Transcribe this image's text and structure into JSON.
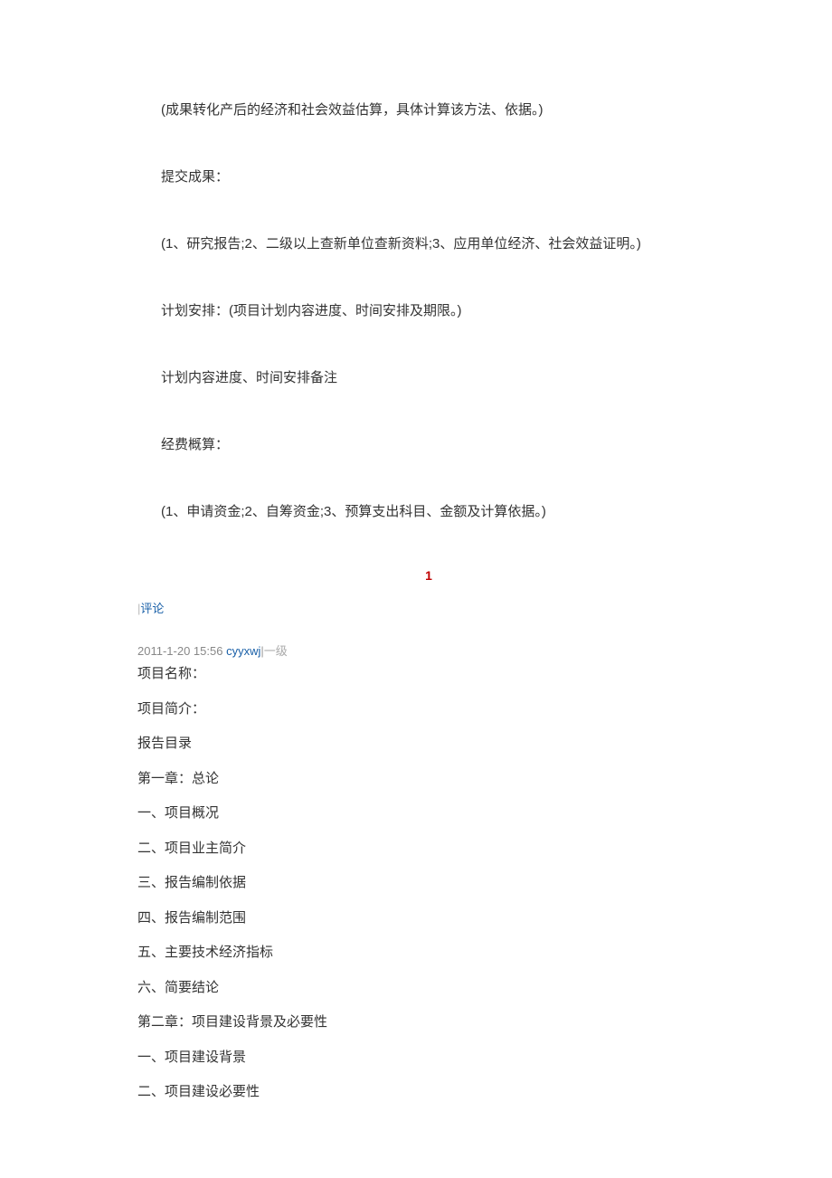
{
  "paragraphs": {
    "p1": "(成果转化产后的经济和社会效益估算，具体计算该方法、依据。)",
    "p2": "提交成果：",
    "p3": "(1、研究报告;2、二级以上查新单位查新资料;3、应用单位经济、社会效益证明。)",
    "p4": "计划安排：(项目计划内容进度、时间安排及期限。)",
    "p5": "计划内容进度、时间安排备注",
    "p6": "经费概算：",
    "p7": "(1、申请资金;2、自筹资金;3、预算支出科目、金额及计算依据。)"
  },
  "page_num": "1",
  "comment": {
    "bar": "|",
    "label": "评论"
  },
  "meta": {
    "timestamp": "2011-1-20 15:56",
    "user": "cyyxwj",
    "bar": "|",
    "level": "一级"
  },
  "lines": {
    "l1": "项目名称：",
    "l2": "项目简介：",
    "l3": "报告目录",
    "l4": "第一章：总论",
    "l5": "一、项目概况",
    "l6": "二、项目业主简介",
    "l7": "三、报告编制依据",
    "l8": "四、报告编制范围",
    "l9": "五、主要技术经济指标",
    "l10": "六、简要结论",
    "l11": "第二章：项目建设背景及必要性",
    "l12": "一、项目建设背景",
    "l13": "二、项目建设必要性"
  }
}
